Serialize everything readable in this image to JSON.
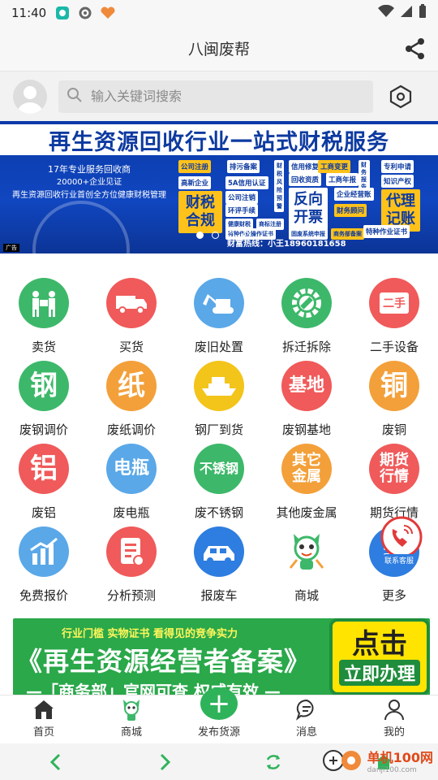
{
  "status_bar": {
    "time": "11:40"
  },
  "app_bar": {
    "title": "八闽废帮"
  },
  "search": {
    "placeholder": "输入关键词搜索"
  },
  "banner": {
    "headline": "再生资源回收行业一站式财税服务",
    "left_lines": [
      "17年专业服务回收商",
      "20000+企业见证",
      "再生资源回收行业首创全方位健康财税管理"
    ],
    "tags": [
      "公司注册",
      "排污备案",
      "财税风险预警",
      "信用修复",
      "工商变更",
      "财务报告",
      "专利申请",
      "高新企业",
      "5A信用认证",
      "回收资质",
      "工商年报",
      "知识产权",
      "公司注销",
      "企业经营账",
      "财税合规",
      "环评手续",
      "反向开票",
      "代理记账",
      "健康财税",
      "商标注册",
      "财务顾问",
      "固废系统申报",
      "商务部备案",
      "特种作业操作证书",
      "特种作业证书"
    ],
    "big_tags": [
      "财税合规",
      "反向开票",
      "代理记账"
    ],
    "hotline": "财富热线：小王18960181658",
    "ad_label": "广告",
    "slide_count": 4,
    "active_slide": 1
  },
  "grid": [
    {
      "label": "卖货",
      "icon": "seller-icon",
      "color": "#3db86a"
    },
    {
      "label": "买货",
      "icon": "truck-icon",
      "color": "#f05a5a"
    },
    {
      "label": "废旧处置",
      "icon": "excavator-icon",
      "color": "#5aa8e8"
    },
    {
      "label": "拆迁拆除",
      "icon": "gear-wrench-icon",
      "color": "#3db86a"
    },
    {
      "label": "二手设备",
      "icon": "secondhand-icon",
      "color": "#f05a5a",
      "glyph": "二手"
    },
    {
      "label": "废钢调价",
      "icon": "steel-icon",
      "color": "#3db86a",
      "glyph": "钢"
    },
    {
      "label": "废纸调价",
      "icon": "paper-icon",
      "color": "#f3a03a",
      "glyph": "纸"
    },
    {
      "label": "钢厂到货",
      "icon": "ship-icon",
      "color": "#f3c41a"
    },
    {
      "label": "废钢基地",
      "icon": "base-icon",
      "color": "#f05a5a",
      "glyph": "基地"
    },
    {
      "label": "废铜",
      "icon": "copper-icon",
      "color": "#f3a03a",
      "glyph": "铜"
    },
    {
      "label": "废铝",
      "icon": "aluminum-icon",
      "color": "#f05a5a",
      "glyph": "铝"
    },
    {
      "label": "废电瓶",
      "icon": "battery-icon",
      "color": "#5aa8e8",
      "glyph": "电瓶"
    },
    {
      "label": "废不锈钢",
      "icon": "stainless-icon",
      "color": "#3db86a",
      "glyph": "不锈钢"
    },
    {
      "label": "其他废金属",
      "icon": "other-metal-icon",
      "color": "#f3a03a",
      "glyph": "其它金属"
    },
    {
      "label": "期货行情",
      "icon": "futures-icon",
      "color": "#f05a5a",
      "glyph": "期货行情"
    },
    {
      "label": "免费报价",
      "icon": "chart-up-icon",
      "color": "#5aa8e8"
    },
    {
      "label": "分析预测",
      "icon": "report-icon",
      "color": "#f05a5a"
    },
    {
      "label": "报废车",
      "icon": "car-icon",
      "color": "#2e7de0"
    },
    {
      "label": "商城",
      "icon": "mascot-icon",
      "color": "#ffffff"
    },
    {
      "label": "更多",
      "icon": "more-icon",
      "color": "#2e7de0"
    }
  ],
  "float_phone": {
    "label": "联系客服"
  },
  "promo": {
    "sub": "行业门槛 实物证书 看得见的竞争实力",
    "main": "《再生资源经营者备案》",
    "foot": "—「商务部」官网可查 权威有效 —",
    "cta1": "点击",
    "cta2": "立即办理"
  },
  "tabs": [
    {
      "label": "首页",
      "icon": "home-icon"
    },
    {
      "label": "商城",
      "icon": "mascot-icon"
    },
    {
      "label": "发布货源",
      "icon": "plus-icon"
    },
    {
      "label": "消息",
      "icon": "message-icon"
    },
    {
      "label": "我的",
      "icon": "person-icon"
    }
  ],
  "watermark": {
    "text": "单机100网",
    "url": "danji100.com"
  },
  "colors": {
    "accent_green": "#2fb35a",
    "banner_blue": "#0d3aa0",
    "tag_yellow": "#ffc21a"
  }
}
